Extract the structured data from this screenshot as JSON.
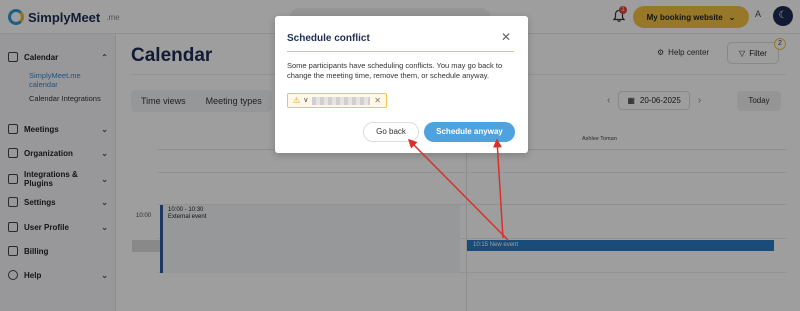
{
  "header": {
    "logo_text": "SimplyMeet",
    "logo_suffix": ".me",
    "notification_count": "1",
    "booking_button": "My booking website",
    "avatar_letter": "A"
  },
  "sidebar": {
    "items": [
      {
        "label": "Calendar",
        "icon": "calendar-icon"
      },
      {
        "label": "Meetings",
        "icon": "meetings-icon"
      },
      {
        "label": "Organization",
        "icon": "organization-icon"
      },
      {
        "label": "Integrations & Plugins",
        "icon": "plug-icon"
      },
      {
        "label": "Settings",
        "icon": "code-icon"
      },
      {
        "label": "User Profile",
        "icon": "user-icon"
      },
      {
        "label": "Billing",
        "icon": "billing-icon"
      },
      {
        "label": "Help",
        "icon": "help-icon"
      }
    ],
    "sub_items": [
      "SimplyMeet.me calendar",
      "Calendar Integrations"
    ]
  },
  "main": {
    "title": "Calendar",
    "help_center": "Help center",
    "filter": "Filter",
    "filter_badge": "2",
    "tabs": [
      "Time views",
      "Meeting types"
    ],
    "date": "20-06-2025",
    "today": "Today",
    "person": "Ashlee Toman",
    "time_label": "10:00",
    "event_external_time": "10:00 - 10:30",
    "event_external_title": "External event",
    "event_new": "10:15 New event"
  },
  "modal": {
    "title": "Schedule conflict",
    "body": "Some participants have scheduling conflicts. You may go back to change the meeting time, remove them, or schedule anyway.",
    "chip_prefix": "v",
    "back_button": "Go back",
    "anyway_button": "Schedule anyway"
  },
  "colors": {
    "accent_blue": "#4da3e0",
    "brand_yellow": "#f3c242",
    "navy": "#1f2d54",
    "annotation_red": "#d9302b"
  }
}
